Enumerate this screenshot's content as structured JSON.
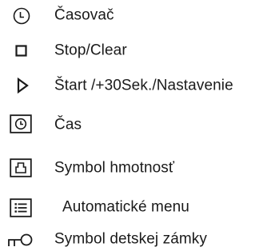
{
  "legend": {
    "items": [
      {
        "icon": "timer-icon",
        "label": "Časovač"
      },
      {
        "icon": "stop-square-icon",
        "label": "Stop/Clear"
      },
      {
        "icon": "play-triangle-icon",
        "label": "Štart /+30Sek./Nastavenie"
      },
      {
        "icon": "clock-icon",
        "label": "Čas"
      },
      {
        "icon": "weight-icon",
        "label": "Symbol hmotnosť"
      },
      {
        "icon": "menu-list-icon",
        "label": "Automatické menu"
      },
      {
        "icon": "child-lock-key-icon",
        "label": "Symbol detskej zámky"
      }
    ]
  }
}
